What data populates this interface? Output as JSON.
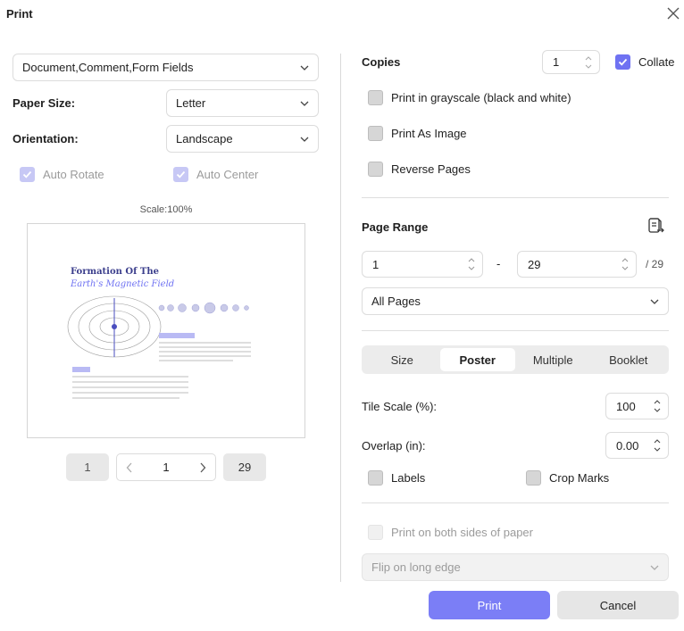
{
  "dialog": {
    "title": "Print"
  },
  "left": {
    "content_select": "Document,Comment,Form Fields",
    "paper_size_label": "Paper Size:",
    "paper_size_value": "Letter",
    "orientation_label": "Orientation:",
    "orientation_value": "Landscape",
    "auto_rotate_label": "Auto Rotate",
    "auto_center_label": "Auto Center",
    "scale_text": "Scale:100%",
    "preview": {
      "heading_line1": "Formation Of The",
      "heading_line2": "Earth's Magnetic Field"
    },
    "pager": {
      "first": "1",
      "current": "1",
      "last": "29"
    }
  },
  "right": {
    "copies_label": "Copies",
    "copies_value": "1",
    "collate_label": "Collate",
    "grayscale_label": "Print in grayscale (black and white)",
    "as_image_label": "Print As Image",
    "reverse_label": "Reverse Pages",
    "page_range_label": "Page Range",
    "range_from": "1",
    "range_dash": "-",
    "range_to": "29",
    "range_total": "/ 29",
    "pages_select": "All Pages",
    "tabs": [
      "Size",
      "Poster",
      "Multiple",
      "Booklet"
    ],
    "active_tab": "Poster",
    "tile_scale_label": "Tile Scale (%):",
    "tile_scale_value": "100",
    "overlap_label": "Overlap (in):",
    "overlap_value": "0.00",
    "labels_label": "Labels",
    "crop_marks_label": "Crop Marks",
    "both_sides_label": "Print on both sides of paper",
    "flip_select": "Flip on long edge"
  },
  "buttons": {
    "print": "Print",
    "cancel": "Cancel"
  },
  "colors": {
    "accent": "#6f72f2",
    "print_button": "#7b7ef6"
  }
}
